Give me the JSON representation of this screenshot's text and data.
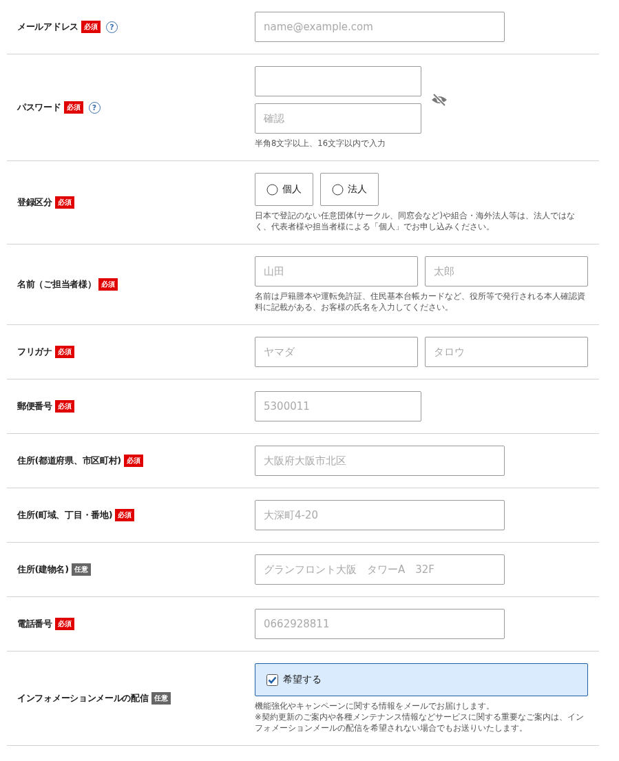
{
  "rows": [
    {
      "label": "メールアドレス",
      "badge": {
        "kind": "required",
        "text": "必須"
      },
      "help": "?",
      "control": {
        "kind": "text",
        "fields": [
          {
            "placeholder": "name@example.com",
            "kind": "email"
          }
        ]
      }
    },
    {
      "label": "パスワード",
      "badge": {
        "kind": "required",
        "text": "必須"
      },
      "help": "?",
      "control": {
        "kind": "password",
        "password_visible": false,
        "fields": [
          {
            "kind": "password"
          },
          {
            "placeholder": "確認",
            "kind": "password"
          }
        ]
      },
      "notes": [
        "半角8文字以上、16文字以内で入力"
      ]
    },
    {
      "label": "登録区分",
      "badge": {
        "kind": "required",
        "text": "必須"
      },
      "control": {
        "kind": "radio",
        "options": [
          {
            "label": "個人",
            "selected": false
          },
          {
            "label": "法人",
            "selected": false
          }
        ]
      },
      "notes": [
        "日本で登記のない任意団体(サークル、同窓会など)や組合・海外法人等は、法人ではなく、代表者様や担当者様による「個人」でお申し込みください。"
      ]
    },
    {
      "label": "名前（ご担当者様）",
      "badge": {
        "kind": "required",
        "text": "必須"
      },
      "control": {
        "kind": "text",
        "fields": [
          {
            "placeholder": "山田",
            "kind": "name"
          },
          {
            "placeholder": "太郎",
            "kind": "name"
          }
        ]
      },
      "notes": [
        "名前は戸籍謄本や運転免許証、住民基本台帳カードなど、役所等で発行される本人確認資料に記載がある、お客様の氏名を入力してください。"
      ]
    },
    {
      "label": "フリガナ",
      "badge": {
        "kind": "required",
        "text": "必須"
      },
      "control": {
        "kind": "text",
        "fields": [
          {
            "placeholder": "ヤマダ",
            "kind": "name"
          },
          {
            "placeholder": "タロウ",
            "kind": "name"
          }
        ]
      }
    },
    {
      "label": "郵便番号",
      "badge": {
        "kind": "required",
        "text": "必須"
      },
      "control": {
        "kind": "text",
        "fields": [
          {
            "placeholder": "5300011",
            "kind": "postal"
          }
        ]
      }
    },
    {
      "label": "住所(都道府県、市区町村)",
      "badge": {
        "kind": "required",
        "text": "必須"
      },
      "control": {
        "kind": "text",
        "fields": [
          {
            "placeholder": "大阪府大阪市北区",
            "kind": "address"
          }
        ]
      }
    },
    {
      "label": "住所(町域、丁目・番地)",
      "badge": {
        "kind": "required",
        "text": "必須"
      },
      "control": {
        "kind": "text",
        "fields": [
          {
            "placeholder": "大深町4-20",
            "kind": "address"
          }
        ]
      }
    },
    {
      "label": "住所(建物名)",
      "badge": {
        "kind": "optional",
        "text": "任意"
      },
      "control": {
        "kind": "text",
        "fields": [
          {
            "placeholder": "グランフロント大阪　タワーA　32F",
            "kind": "address"
          }
        ]
      }
    },
    {
      "label": "電話番号",
      "badge": {
        "kind": "required",
        "text": "必須"
      },
      "control": {
        "kind": "text",
        "fields": [
          {
            "placeholder": "0662928811",
            "kind": "phone"
          }
        ]
      }
    },
    {
      "label": "インフォメーションメールの配信",
      "badge": {
        "kind": "optional",
        "text": "任意"
      },
      "control": {
        "kind": "checkbox",
        "label": "希望する",
        "checked": true
      },
      "notes": [
        "機能強化やキャンペーンに関する情報をメールでお届けします。",
        "※契約更新のご案内や各種メンテナンス情報などサービスに関する重要なご案内は、インフォメーションメールの配信を希望されない場合でもお送りいたします。"
      ]
    }
  ]
}
